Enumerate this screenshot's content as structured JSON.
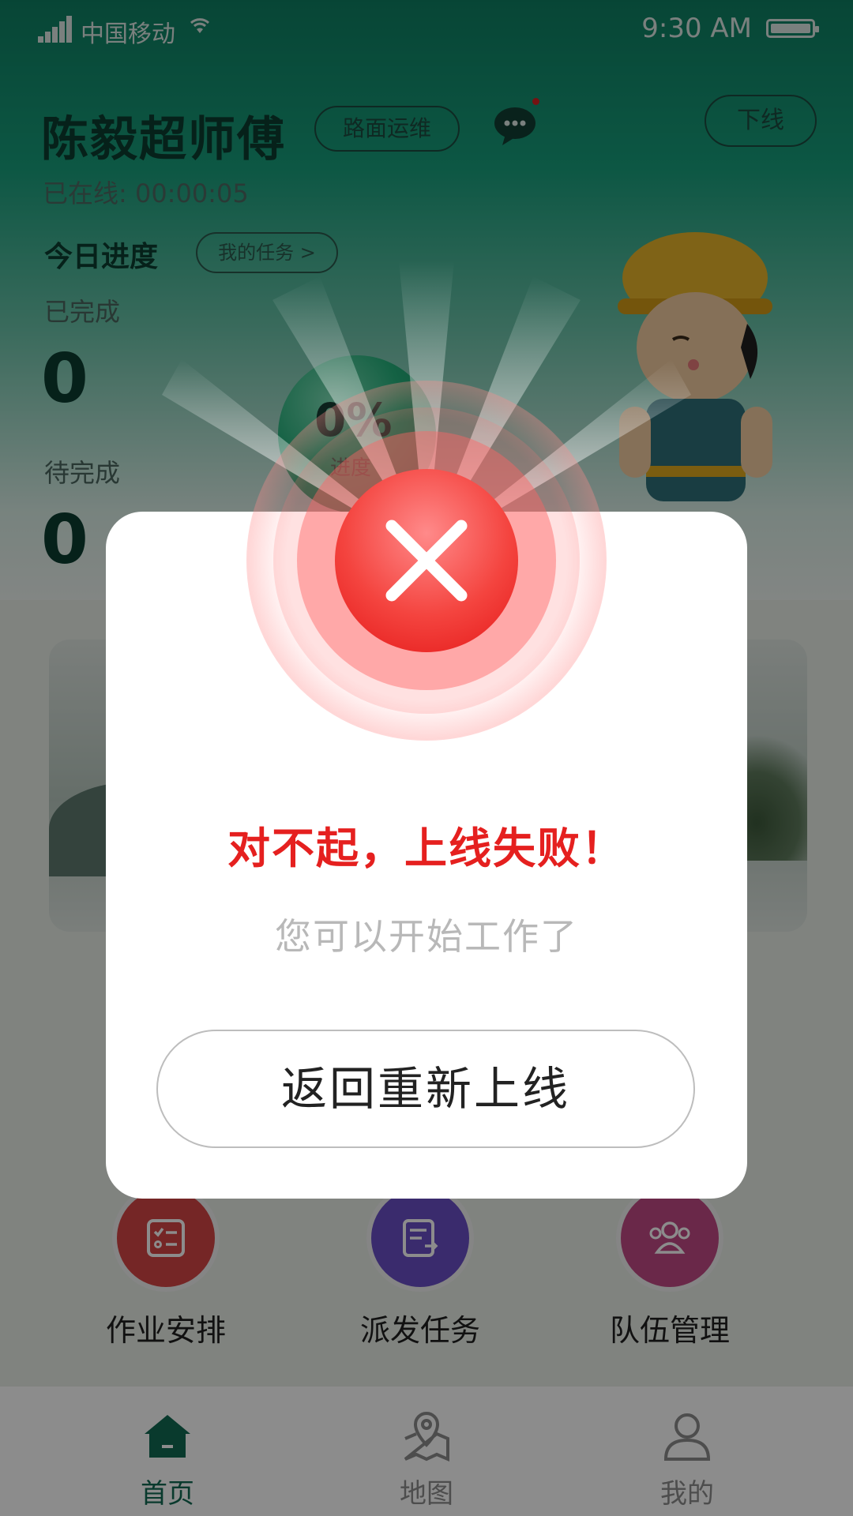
{
  "status_bar": {
    "carrier": "中国移动",
    "time": "9:30 AM"
  },
  "header": {
    "user_name": "陈毅超师傅",
    "role_tag": "路面运维",
    "offline_button": "下线",
    "online_time": "已在线: 00:00:05"
  },
  "progress": {
    "title": "今日进度",
    "my_tasks_link": "我的任务 >",
    "done_label": "已完成",
    "done_value": "0",
    "todo_label": "待完成",
    "todo_value": "0",
    "percent_text": "0%",
    "percent_sub": "进度"
  },
  "grid": {
    "items": [
      {
        "label": "作业安排",
        "color": "#d64545"
      },
      {
        "label": "派发任务",
        "color": "#6b4fc6"
      },
      {
        "label": "队伍管理",
        "color": "#c24a86"
      }
    ]
  },
  "tabbar": {
    "items": [
      {
        "label": "首页",
        "active": true
      },
      {
        "label": "地图",
        "active": false
      },
      {
        "label": "我的",
        "active": false
      }
    ],
    "active_color": "#116a52"
  },
  "dialog": {
    "title": "对不起，上线失败！",
    "subtitle": "您可以开始工作了",
    "button": "返回重新上线",
    "title_color": "#e5201f"
  }
}
